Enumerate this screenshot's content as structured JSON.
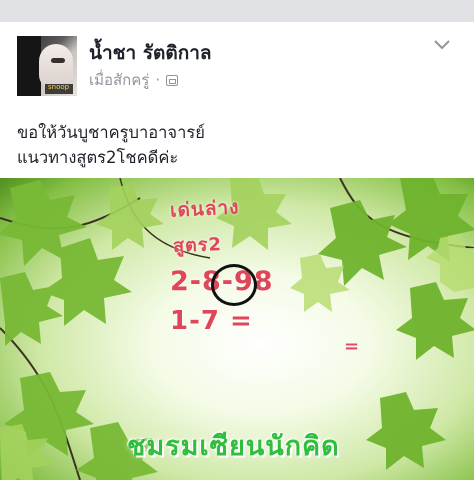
{
  "post": {
    "author": "น้ำชา รัตติกาล",
    "timestamp": "เมื่อสักครู่",
    "separator": "·",
    "privacy_icon": "public-globe-icon",
    "menu_icon": "chevron-down-icon",
    "text_lines": [
      "ขอให้วันบูชาครูบาอาจารย์",
      "แนวทางสูตร2โชคดีค่ะ"
    ]
  },
  "photo": {
    "lines": [
      "เด่นล่าง",
      "สูตร2",
      "2-8-98",
      "1-7 =",
      "="
    ],
    "circled_digit": "8",
    "club_name": "ชมรมเซียนนักคิด"
  },
  "colors": {
    "background": "#dfe1e4",
    "text": "#1d2129",
    "meta": "#90949c",
    "handwriting": "#e0465a",
    "club_name": "#2fbf3c",
    "leaf_green": "#6fb32d"
  }
}
